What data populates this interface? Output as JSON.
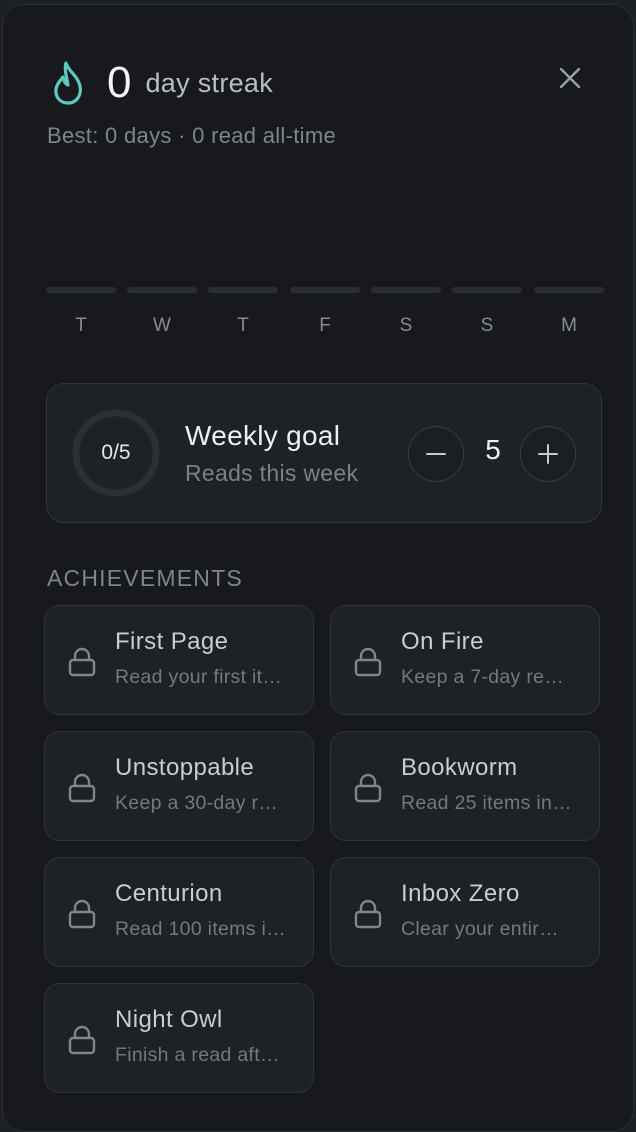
{
  "streak": {
    "count": "0",
    "label": "day streak",
    "summary": "Best: 0 days · 0 read all-time"
  },
  "week": {
    "days": [
      "T",
      "W",
      "T",
      "F",
      "S",
      "S",
      "M"
    ],
    "reads_per_day": [
      0,
      0,
      0,
      0,
      0,
      0,
      0
    ]
  },
  "goal": {
    "progress_text": "0/5",
    "progress_fraction": 0,
    "title": "Weekly goal",
    "subtitle": "Reads this week",
    "target": "5"
  },
  "achievements": {
    "heading": "ACHIEVEMENTS",
    "items": [
      {
        "title": "First Page",
        "desc": "Read your first it…",
        "locked": true
      },
      {
        "title": "On Fire",
        "desc": "Keep a 7-day re…",
        "locked": true
      },
      {
        "title": "Unstoppable",
        "desc": "Keep a 30-day r…",
        "locked": true
      },
      {
        "title": "Bookworm",
        "desc": "Read 25 items in…",
        "locked": true
      },
      {
        "title": "Centurion",
        "desc": "Read 100 items i…",
        "locked": true
      },
      {
        "title": "Inbox Zero",
        "desc": "Clear your entir…",
        "locked": true
      },
      {
        "title": "Night Owl",
        "desc": "Finish a read aft…",
        "locked": true
      }
    ]
  },
  "icons": {
    "streak": "flame-icon",
    "close": "close-icon",
    "decrement": "minus-icon",
    "increment": "plus-icon",
    "locked": "lock-icon"
  },
  "colors": {
    "accent": "#5fc8c0",
    "panel": "#17191c",
    "card": "#1e2125"
  }
}
